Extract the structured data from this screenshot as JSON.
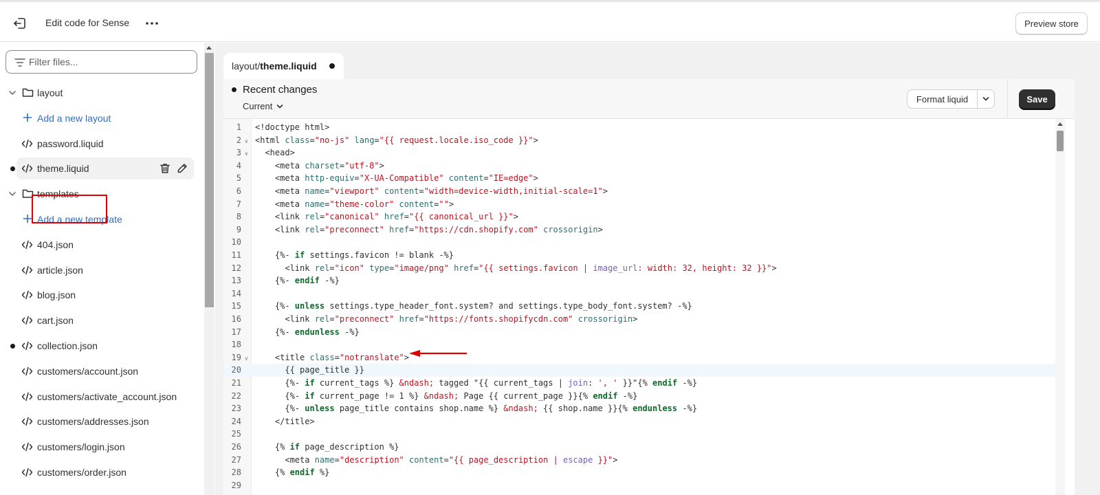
{
  "topbar": {
    "title": "Edit code for Sense",
    "preview_label": "Preview store",
    "exit_icon": "exit-icon",
    "more_icon": "more-horizontal-icon"
  },
  "sidebar": {
    "filter_placeholder": "Filter files...",
    "items": [
      {
        "type": "folder",
        "label": "layout"
      },
      {
        "type": "add",
        "label": "Add a new layout"
      },
      {
        "type": "file",
        "label": "password.liquid"
      },
      {
        "type": "file",
        "label": "theme.liquid",
        "active": true,
        "modified": true
      },
      {
        "type": "folder",
        "label": "templates"
      },
      {
        "type": "add",
        "label": "Add a new template"
      },
      {
        "type": "file",
        "label": "404.json"
      },
      {
        "type": "file",
        "label": "article.json"
      },
      {
        "type": "file",
        "label": "blog.json"
      },
      {
        "type": "file",
        "label": "cart.json"
      },
      {
        "type": "file",
        "label": "collection.json",
        "modified": true
      },
      {
        "type": "file",
        "label": "customers/account.json"
      },
      {
        "type": "file",
        "label": "customers/activate_account.json"
      },
      {
        "type": "file",
        "label": "customers/addresses.json"
      },
      {
        "type": "file",
        "label": "customers/login.json"
      },
      {
        "type": "file",
        "label": "customers/order.json"
      }
    ]
  },
  "editor": {
    "tab_prefix": "layout/",
    "tab_file": "theme.liquid",
    "recent_changes": "Recent changes",
    "current_label": "Current",
    "format_label": "Format liquid",
    "save_label": "Save",
    "active_line": 20,
    "lines": [
      {
        "n": "1",
        "fold": false,
        "html": "&lt;!doctype html&gt;"
      },
      {
        "n": "2",
        "fold": true,
        "html": "&lt;html <span class='t-attr'>class</span>=<span class='t-str'>\"no-js\"</span> <span class='t-attr'>lang</span>=<span class='t-str'>\"{{ request.locale.iso_code }}\"</span>&gt;"
      },
      {
        "n": "3",
        "fold": true,
        "html": "  &lt;head&gt;"
      },
      {
        "n": "4",
        "fold": false,
        "html": "    &lt;meta <span class='t-attr'>charset</span>=<span class='t-str'>\"utf-8\"</span>&gt;"
      },
      {
        "n": "5",
        "fold": false,
        "html": "    &lt;meta <span class='t-attr'>http-equiv</span>=<span class='t-str'>\"X-UA-Compatible\"</span> <span class='t-attr'>content</span>=<span class='t-str'>\"IE=edge\"</span>&gt;"
      },
      {
        "n": "6",
        "fold": false,
        "html": "    &lt;meta <span class='t-attr'>name</span>=<span class='t-str'>\"viewport\"</span> <span class='t-attr'>content</span>=<span class='t-str'>\"width=device-width,initial-scale=1\"</span>&gt;"
      },
      {
        "n": "7",
        "fold": false,
        "html": "    &lt;meta <span class='t-attr'>name</span>=<span class='t-str'>\"theme-color\"</span> <span class='t-attr'>content</span>=<span class='t-str'>\"\"</span>&gt;"
      },
      {
        "n": "8",
        "fold": false,
        "html": "    &lt;link <span class='t-attr'>rel</span>=<span class='t-str'>\"canonical\"</span> <span class='t-attr'>href</span>=<span class='t-str'>\"{{ canonical_url }}\"</span>&gt;"
      },
      {
        "n": "9",
        "fold": false,
        "html": "    &lt;link <span class='t-attr'>rel</span>=<span class='t-str'>\"preconnect\"</span> <span class='t-attr'>href</span>=<span class='t-str'>\"https://cdn.shopify.com\"</span> <span class='t-attr'>crossorigin</span>&gt;"
      },
      {
        "n": "10",
        "fold": false,
        "html": ""
      },
      {
        "n": "11",
        "fold": false,
        "html": "    {%- <span class='t-kw'>if</span> settings.favicon != blank -%}"
      },
      {
        "n": "12",
        "fold": false,
        "html": "      &lt;link <span class='t-attr'>rel</span>=<span class='t-str'>\"icon\"</span> <span class='t-attr'>type</span>=<span class='t-str'>\"image/png\"</span> <span class='t-attr'>href</span>=<span class='t-str'>\"{{ settings.favicon | <span class='t-filter'>image_url</span>: width: 32, height: 32 }}\"</span>&gt;"
      },
      {
        "n": "13",
        "fold": false,
        "html": "    {%- <span class='t-kw'>endif</span> -%}"
      },
      {
        "n": "14",
        "fold": false,
        "html": ""
      },
      {
        "n": "15",
        "fold": false,
        "html": "    {%- <span class='t-kw'>unless</span> settings.type_header_font.system? and settings.type_body_font.system? -%}"
      },
      {
        "n": "16",
        "fold": false,
        "html": "      &lt;link <span class='t-attr'>rel</span>=<span class='t-str'>\"preconnect\"</span> <span class='t-attr'>href</span>=<span class='t-str'>\"https://fonts.shopifycdn.com\"</span> <span class='t-attr'>crossorigin</span>&gt;"
      },
      {
        "n": "17",
        "fold": false,
        "html": "    {%- <span class='t-kw'>endunless</span> -%}"
      },
      {
        "n": "18",
        "fold": false,
        "html": ""
      },
      {
        "n": "19",
        "fold": true,
        "html": "    &lt;title <span class='t-attr'>class</span>=<span class='t-str'>\"notranslate\"</span>&gt;"
      },
      {
        "n": "20",
        "fold": false,
        "html": "      {{ page_title }}"
      },
      {
        "n": "21",
        "fold": false,
        "html": "      {%- <span class='t-kw'>if</span> current_tags %} <span class='t-str'>&amp;ndash;</span> tagged \"{{ current_tags | <span class='t-filter'>join</span>: <span class='t-str'>', '</span> }}\"{% <span class='t-kw'>endif</span> -%}"
      },
      {
        "n": "22",
        "fold": false,
        "html": "      {%- <span class='t-kw'>if</span> current_page != 1 %} <span class='t-str'>&amp;ndash;</span> Page {{ current_page }}{% <span class='t-kw'>endif</span> -%}"
      },
      {
        "n": "23",
        "fold": false,
        "html": "      {%- <span class='t-kw'>unless</span> page_title contains shop.name %} <span class='t-str'>&amp;ndash;</span> {{ shop.name }}{% <span class='t-kw'>endunless</span> -%}"
      },
      {
        "n": "24",
        "fold": false,
        "html": "    &lt;/title&gt;"
      },
      {
        "n": "25",
        "fold": false,
        "html": ""
      },
      {
        "n": "26",
        "fold": false,
        "html": "    {% <span class='t-kw'>if</span> page_description %}"
      },
      {
        "n": "27",
        "fold": false,
        "html": "      &lt;meta <span class='t-attr'>name</span>=<span class='t-str'>\"description\"</span> <span class='t-attr'>content</span>=<span class='t-str'>\"{{ page_description | <span class='t-filter'>escape</span> }}\"</span>&gt;"
      },
      {
        "n": "28",
        "fold": false,
        "html": "    {% <span class='t-kw'>endif</span> %}"
      },
      {
        "n": "29",
        "fold": false,
        "html": ""
      }
    ]
  },
  "colors": {
    "accent_link": "#2c6ecb",
    "annotation_red": "#e00000",
    "save_bg": "#303030"
  }
}
